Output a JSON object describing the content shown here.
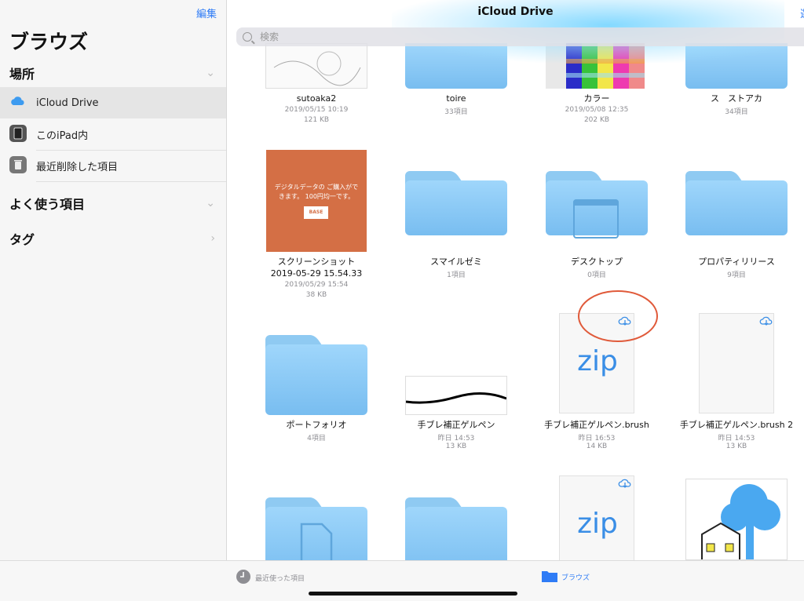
{
  "sidebar": {
    "edit_label": "編集",
    "title": "ブラウズ",
    "locations_header": "場所",
    "locations": [
      {
        "label": "iCloud Drive",
        "icon": "icloud-icon",
        "selected": true
      },
      {
        "label": "このiPad内",
        "icon": "ipad-icon",
        "selected": false
      },
      {
        "label": "最近削除した項目",
        "icon": "trash-icon",
        "selected": false
      }
    ],
    "favorites_header": "よく使う項目",
    "tags_header": "タグ"
  },
  "main": {
    "title": "iCloud Drive",
    "select_label": "選",
    "search_placeholder": "検索",
    "items": [
      {
        "name": "sutoaka2",
        "date": "2019/05/15 10:19",
        "size": "121 KB",
        "kind": "image-sketch"
      },
      {
        "name": "toire",
        "count": "33項目",
        "kind": "folder"
      },
      {
        "name": "カラー",
        "date": "2019/05/08 12:35",
        "size": "202 KB",
        "kind": "image-colors"
      },
      {
        "name": "ス　ストアカ",
        "count": "34項目",
        "kind": "folder"
      },
      {
        "name": "スクリーンショット\n2019-05-29 15.54.33",
        "name_line1": "スクリーンショット",
        "name_line2": "2019-05-29 15.54.33",
        "date": "2019/05/29 15:54",
        "size": "38 KB",
        "kind": "image-screenshot"
      },
      {
        "name": "スマイルゼミ",
        "count": "1項目",
        "kind": "folder"
      },
      {
        "name": "デスクトップ",
        "count": "0項目",
        "kind": "folder-desktop"
      },
      {
        "name": "プロパティリリース",
        "count": "9項目",
        "kind": "folder"
      },
      {
        "name": "ポートフォリオ",
        "count": "4項目",
        "kind": "folder"
      },
      {
        "name": "手ブレ補正ゲルペン",
        "date": "昨日 14:53",
        "size": "13 KB",
        "kind": "image-stroke"
      },
      {
        "name": "手ブレ補正ゲルペン.brush",
        "date": "昨日 16:53",
        "size": "14 KB",
        "kind": "zip",
        "zip_label": "zip"
      },
      {
        "name": "手ブレ補正ゲルペン.brush 2",
        "date": "昨日 14:53",
        "size": "13 KB",
        "kind": "doc-cloud"
      }
    ],
    "screenshot_text": "デジタルデータの ご購入ができます。 100円均一です。",
    "screenshot_badge": "BASE",
    "row4_zip_label": "zip"
  },
  "tabbar": {
    "recents_label": "最近使った項目",
    "browse_label": "ブラウズ",
    "accent": "#2f7cf6"
  }
}
